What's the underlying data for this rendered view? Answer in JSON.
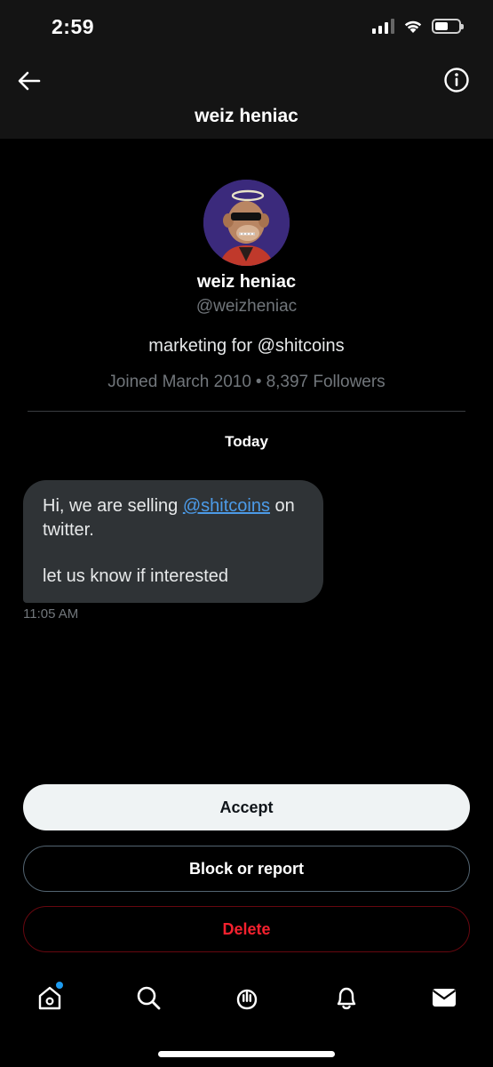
{
  "status_bar": {
    "time": "2:59"
  },
  "header": {
    "title": "weiz heniac"
  },
  "profile": {
    "name": "weiz heniac",
    "handle": "@weizheniac",
    "bio": "marketing for @shitcoins",
    "joined": "Joined March 2010",
    "followers": "8,397 Followers"
  },
  "conversation": {
    "day_label": "Today",
    "message": {
      "text_before": "Hi, we are selling",
      "mention": "@shitcoins",
      "text_after": "on twitter.",
      "line2": "let us know if interested",
      "time": "11:05 AM"
    }
  },
  "actions": {
    "accept": "Accept",
    "block_or_report": "Block or report",
    "delete": "Delete"
  },
  "tabbar": {
    "items": [
      "home-icon",
      "search-icon",
      "spaces-icon",
      "notifications-icon",
      "messages-icon"
    ]
  },
  "colors": {
    "accent": "#1d9bf0",
    "danger": "#f4212e",
    "link": "#4c9be8"
  }
}
